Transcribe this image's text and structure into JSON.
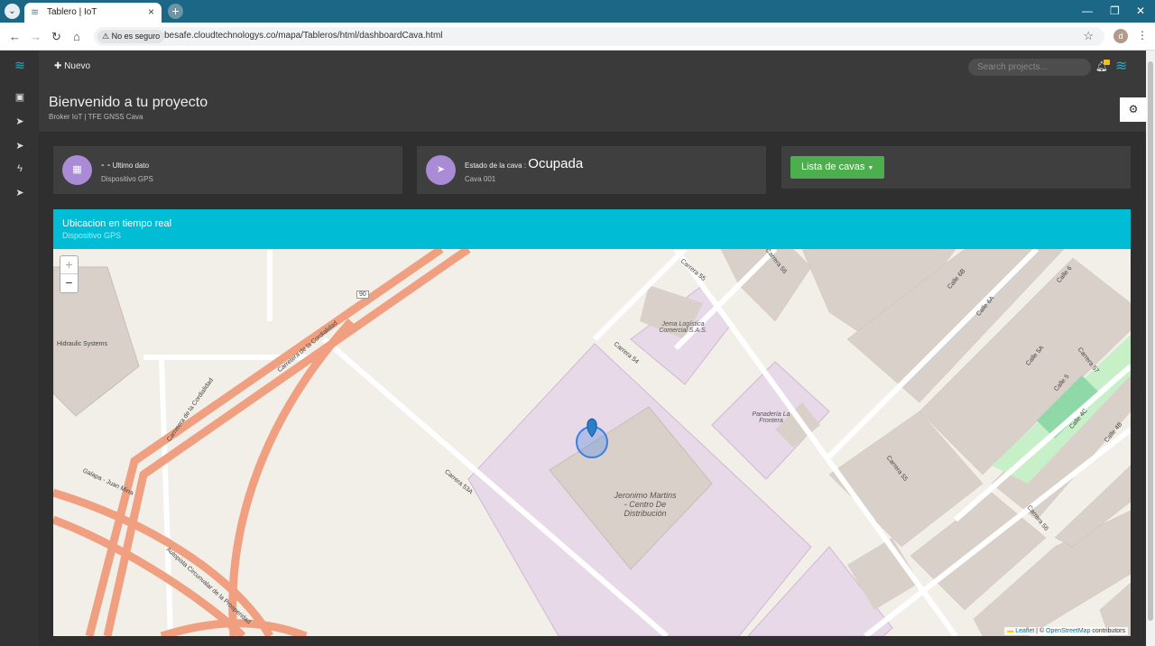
{
  "browser": {
    "tab_title": "Tablero | IoT",
    "security_label": "No es seguro",
    "url": "besafe.cloudtechnologys.co/mapa/Tableros/html/dashboardCava.html",
    "profile_initial": "d"
  },
  "topbar": {
    "new_label": "Nuevo",
    "search_placeholder": "Search projects..."
  },
  "header": {
    "title": "Bienvenido a tu proyecto",
    "subtitle": "Broker IoT | TFE GNSS Cava"
  },
  "cards": {
    "last_data": {
      "value": "- -",
      "label": "Ultimo dato",
      "sub": "Dispositivo GPS"
    },
    "cava_state": {
      "label": "Estado de la cava :",
      "value": "Ocupada",
      "sub": "Cava 001"
    },
    "cava_list": {
      "button": "Lista de cavas"
    }
  },
  "map_panel": {
    "title": "Ubicacion en tiempo real",
    "subtitle": "Dispositivo GPS",
    "zoom_in": "+",
    "zoom_out": "−",
    "attribution_leaflet": "Leaflet",
    "attribution_sep": " | © ",
    "attribution_osm": "OpenStreetMap",
    "attribution_tail": " contributors",
    "labels": {
      "hydraulic": "Hidraulic Systems",
      "route": "90",
      "cordialidad1": "Carretera de la Cordialidad",
      "cordialidad2": "Carretera de la Cordialidad",
      "galapa": "Galapa - Juan Mina",
      "autopista": "Autopista Circunvalar de la Prosperidad",
      "carrera53a": "Carrera 53A",
      "carrera54": "Carrera 54",
      "carrera55a": "Carrera 55",
      "carrera55b": "Carrera 55",
      "carrera56a": "Carrera 56",
      "carrera56b": "Carrera 56",
      "carrera57": "Carrera 57",
      "calle6": "Calle 6",
      "calle6b": "Calle 6B",
      "calle6a": "Calle 6A",
      "calle5a": "Calle 5A",
      "calle5": "Calle 5",
      "calle4c": "Calle 4C",
      "calle4b": "Calle 4B",
      "jema": "Jema Logística Comercial S.A.S.",
      "panaderia": "Panadería La Frontera",
      "jeronimo": "Jeronimo Martins - Centro De Distribución"
    }
  },
  "colors": {
    "accent": "#00bcd4",
    "button_green": "#4cae4c",
    "icon_purple": "#a98bd6",
    "browser_bar": "#1d6786"
  }
}
